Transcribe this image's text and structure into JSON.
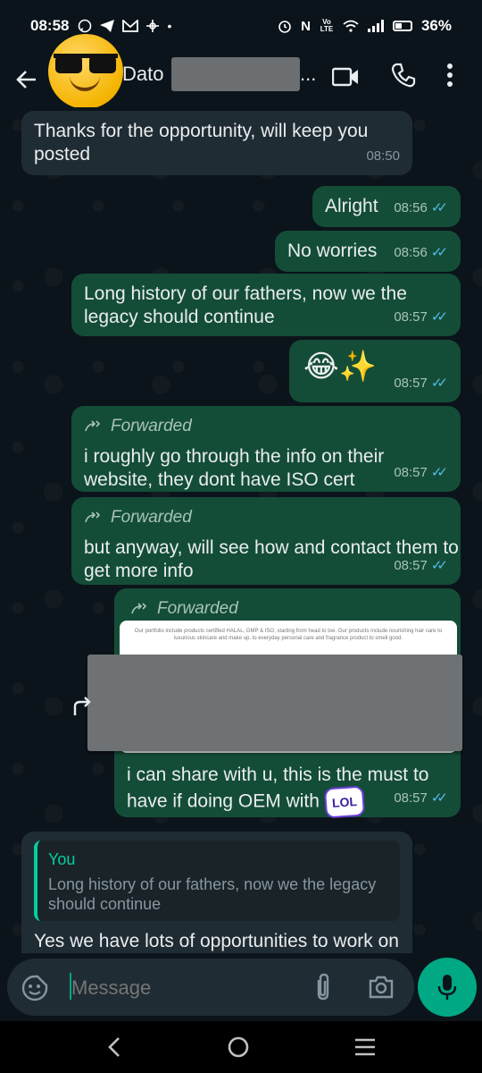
{
  "status_bar": {
    "time": "08:58",
    "battery": "36%",
    "volte": "Vo LTE"
  },
  "header": {
    "contact_name": "Dato",
    "ellipsis": "..."
  },
  "messages": [
    {
      "text": "Thanks for the opportunity, will keep you posted",
      "time": "08:50",
      "direction": "in"
    },
    {
      "text": "Alright",
      "time": "08:56",
      "direction": "out"
    },
    {
      "text": "No worries",
      "time": "08:56",
      "direction": "out"
    },
    {
      "text": "Long history of our fathers, now we the legacy should continue",
      "time": "08:57",
      "direction": "out"
    },
    {
      "text": "😂✨",
      "time": "08:57",
      "direction": "out"
    },
    {
      "forwarded_label": "Forwarded",
      "text": "i roughly go through the info on their website, they dont have ISO cert",
      "time": "08:57",
      "direction": "out"
    },
    {
      "forwarded_label": "Forwarded",
      "text": "but anyway, will see how and contact them to get more info",
      "time": "08:57",
      "direction": "out"
    },
    {
      "forwarded_label": "Forwarded",
      "preview_text": "Our portfolio include products certified HALAL, GMP & ISO, starting from head to toe. Our products include nourishing hair care to luxurious skincare and make up, to everyday personal care and fragrance product to smell good.",
      "text": "i can share with u, this is the must to have if doing OEM with",
      "sticker": "LOL",
      "time": "08:57",
      "direction": "out"
    },
    {
      "quote_author": "You",
      "quote_text": "Long history of our fathers, now we the legacy should continue",
      "text": "Yes we have lots of opportunities to work on together",
      "direction": "in"
    }
  ],
  "input": {
    "placeholder": "Message"
  },
  "colors": {
    "outgoing_bubble": "#144d37",
    "incoming_bubble": "#202c33",
    "accent": "#00a884",
    "read_tick": "#53bdeb"
  }
}
